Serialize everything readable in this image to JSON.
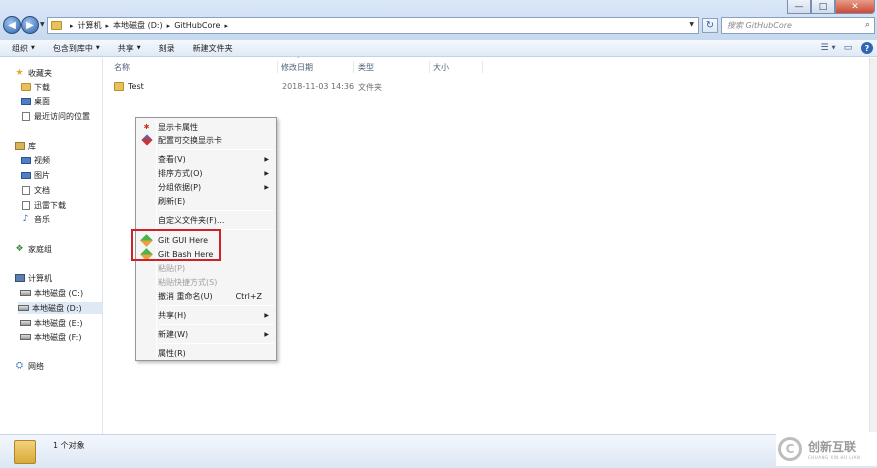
{
  "window": {
    "minimize_glyph": "—",
    "maximize_glyph": "□",
    "close_glyph": "✕"
  },
  "navigation": {
    "back_glyph": "◀",
    "forward_glyph": "▶",
    "dropdown_glyph": "▼",
    "refresh_glyph": "↻"
  },
  "address": {
    "crumb_separator": "▸",
    "crumbs": [
      "计算机",
      "本地磁盘 (D:)",
      "GitHubCore"
    ]
  },
  "search": {
    "placeholder": "搜索 GitHubCore",
    "icon": "search-icon",
    "icon_glyph": "⌕"
  },
  "toolbar": {
    "arrow_glyph": "▼",
    "items": [
      "组织",
      "包含到库中",
      "共享",
      "刻录",
      "新建文件夹"
    ],
    "view_glyph": "☰",
    "preview_glyph": "▭",
    "help_glyph": "?"
  },
  "sidebar": {
    "favorites": {
      "label": "收藏夹",
      "icon": "star-icon",
      "glyph": "★"
    },
    "favorites_items": [
      "下载",
      "桌面",
      "最近访问的位置"
    ],
    "libraries": {
      "label": "库",
      "icon": "library-icon"
    },
    "libraries_items": [
      "视频",
      "图片",
      "文档",
      "迅雷下载",
      "音乐"
    ],
    "music_glyph": "♪",
    "homegroup": {
      "label": "家庭组",
      "icon": "homegroup-icon",
      "glyph": "❖"
    },
    "computer": {
      "label": "计算机",
      "icon": "computer-icon"
    },
    "computer_items": [
      "本地磁盘 (C:)",
      "本地磁盘 (D:)",
      "本地磁盘 (E:)",
      "本地磁盘 (F:)"
    ],
    "selected_item": "本地磁盘 (D:)",
    "network": {
      "label": "网络",
      "icon": "network-icon",
      "glyph": "⛭"
    }
  },
  "file_list": {
    "sort_glyph": "˄",
    "columns": [
      "名称",
      "修改日期",
      "类型",
      "大小"
    ],
    "rows": [
      {
        "name": "Test",
        "modified": "2018-11-03 14:36",
        "type": "文件夹",
        "size": ""
      }
    ]
  },
  "context_menu": {
    "submenu_glyph": "▶",
    "card_glyph": "✱",
    "items": [
      {
        "label": "显示卡属性"
      },
      {
        "label": "配置可交换显示卡"
      },
      {
        "label": "查看(V)"
      },
      {
        "label": "排序方式(O)"
      },
      {
        "label": "分组依据(P)"
      },
      {
        "label": "刷新(E)"
      },
      {
        "label": "自定义文件夹(F)..."
      },
      {
        "label": "Git GUI Here"
      },
      {
        "label": "Git Bash Here"
      },
      {
        "label": "粘贴(P)"
      },
      {
        "label": "粘贴快捷方式(S)"
      },
      {
        "label": "撤消 重命名(U)",
        "shortcut": "Ctrl+Z"
      },
      {
        "label": "共享(H)"
      },
      {
        "label": "新建(W)"
      },
      {
        "label": "属性(R)"
      }
    ]
  },
  "status_bar": {
    "text": "1 个对象"
  },
  "watermark": {
    "logo_glyph": "C",
    "text_cn": "创新互联",
    "text_en": "CHUANG XIN HU LIAN"
  }
}
